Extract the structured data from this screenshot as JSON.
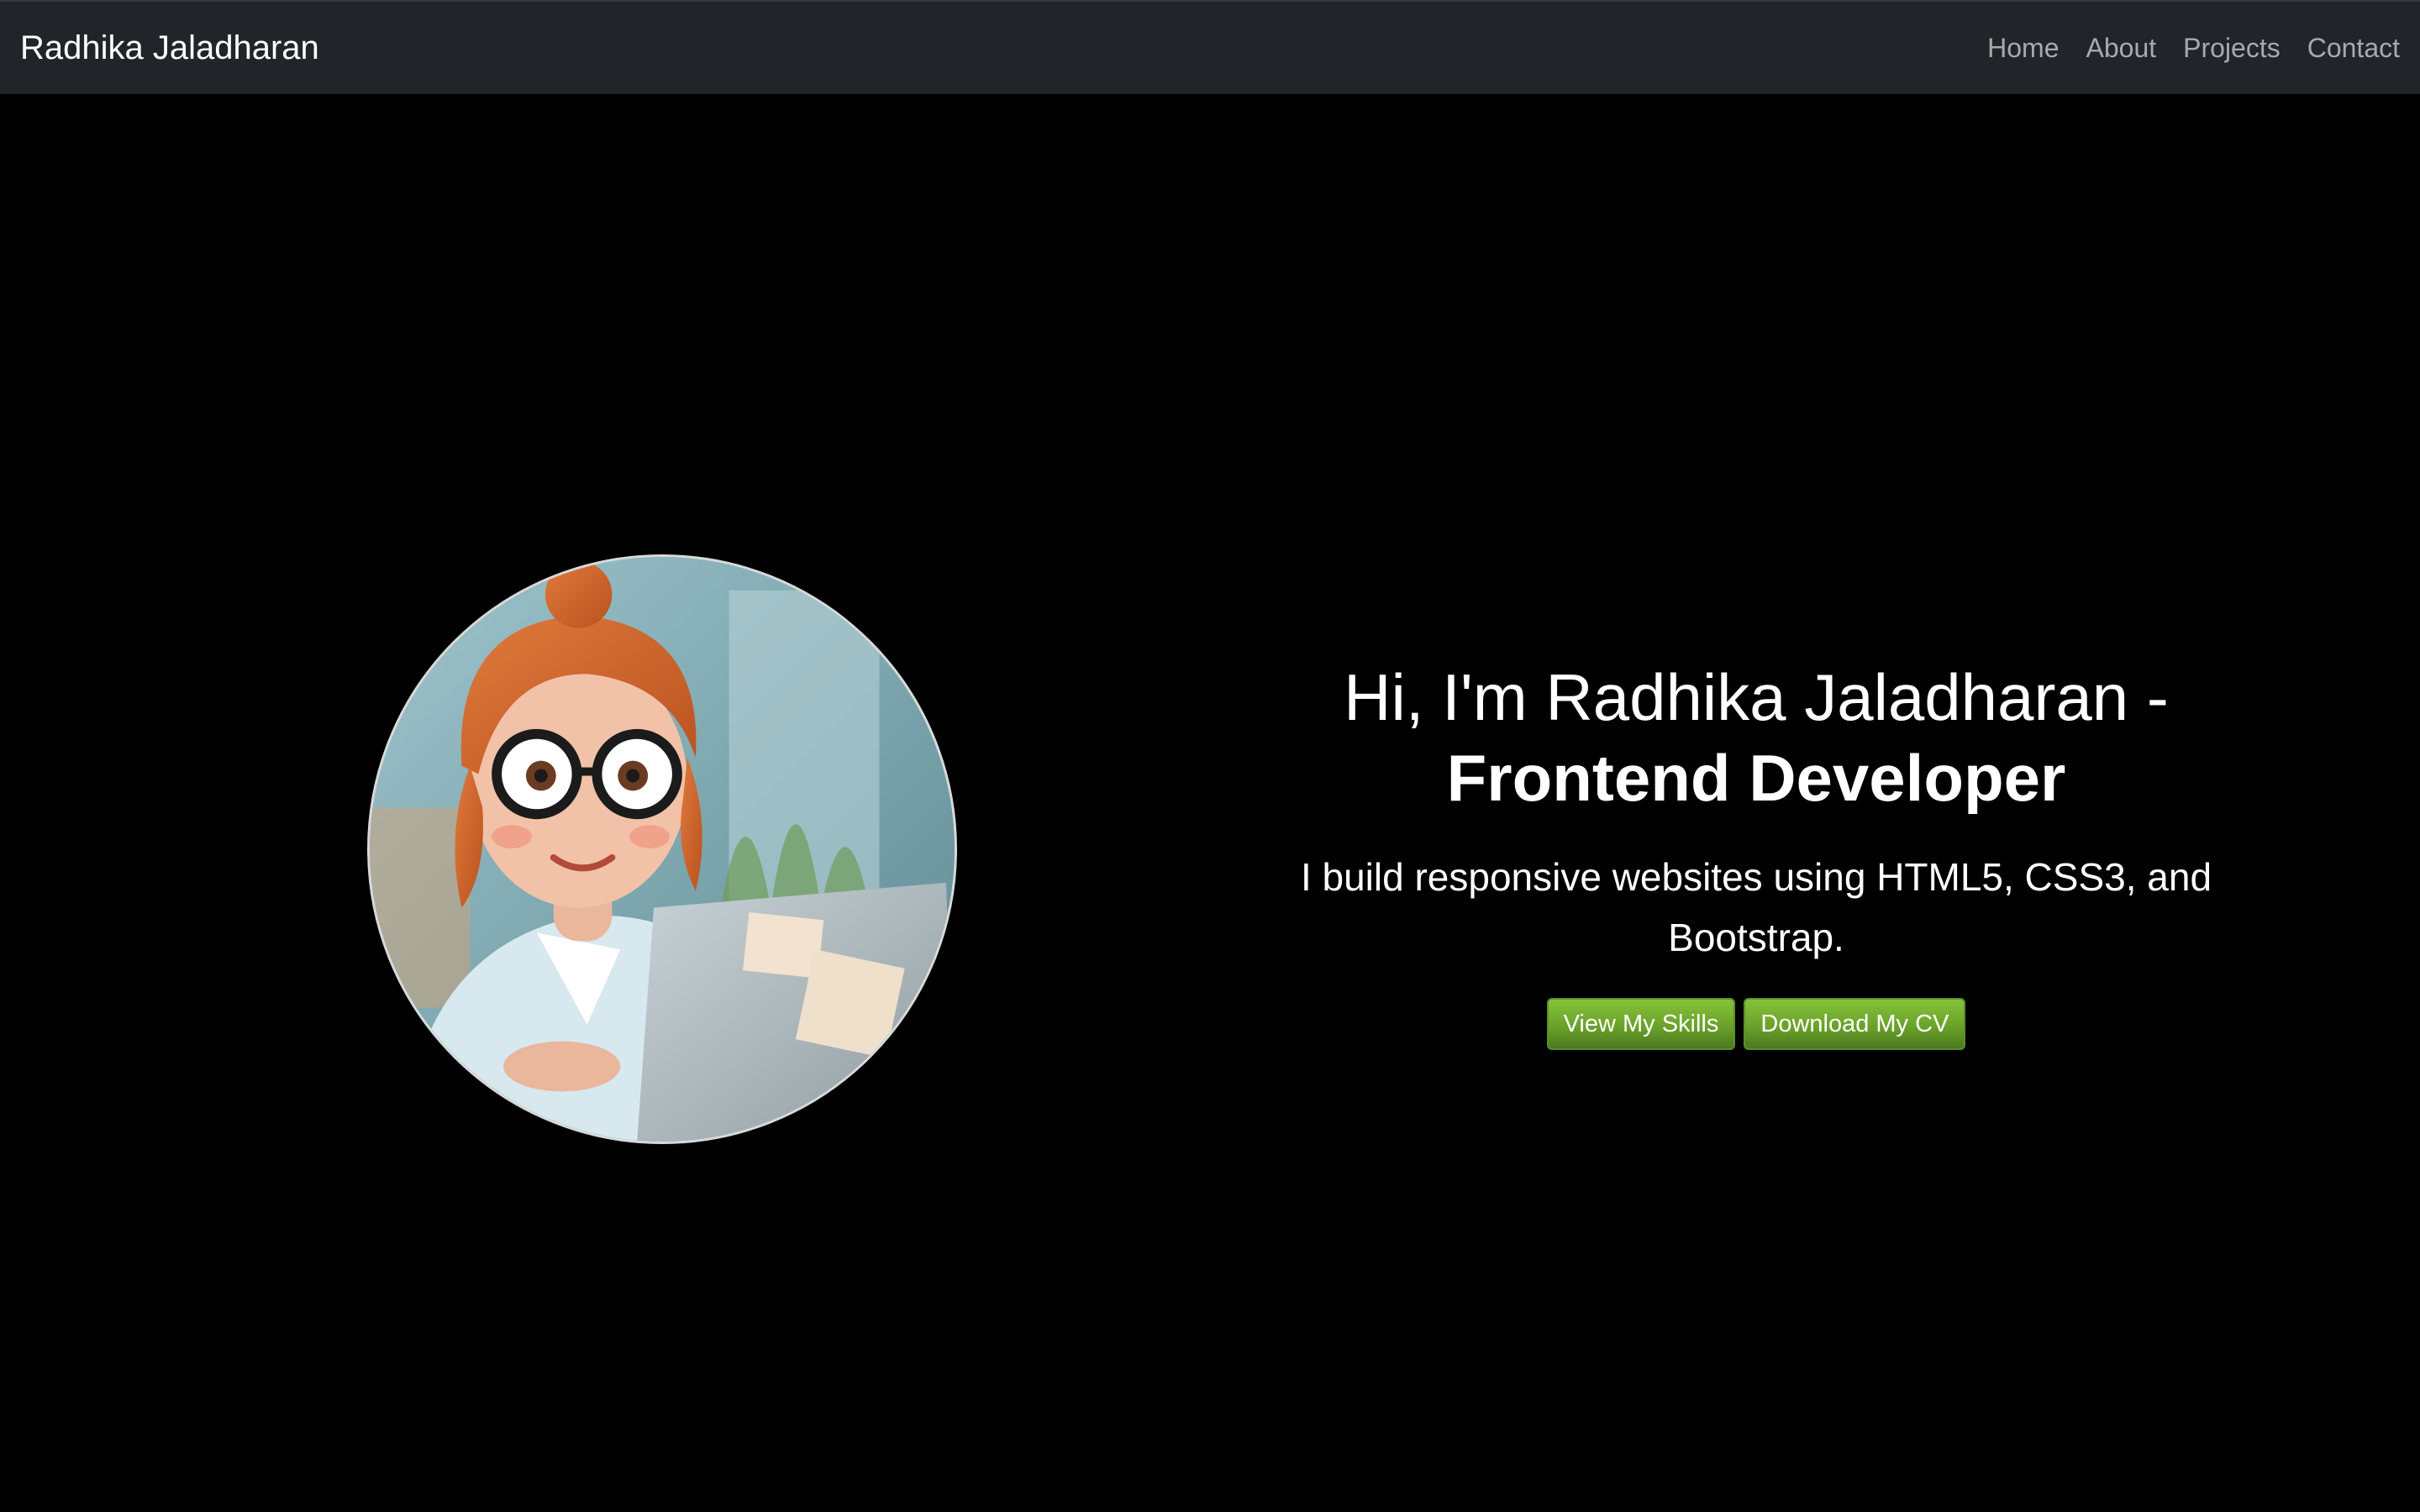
{
  "nav": {
    "brand": "Radhika Jaladharan",
    "links": [
      "Home",
      "About",
      "Projects",
      "Contact"
    ]
  },
  "hero": {
    "headline_line1": "Hi, I'm Radhika Jaladharan -",
    "headline_line2": "Frontend Developer",
    "subtitle": "I build responsive websites using HTML5, CSS3, and Bootstrap.",
    "buttons": {
      "skills": "View My Skills",
      "cv": "Download My CV"
    },
    "image": "illustrated-woman-with-glasses-at-laptop"
  },
  "colors": {
    "page_background": "#000000",
    "navbar_background": "#212529",
    "nav_link": "#a7aaad",
    "text": "#ffffff",
    "button_green": "#6aa22a"
  }
}
